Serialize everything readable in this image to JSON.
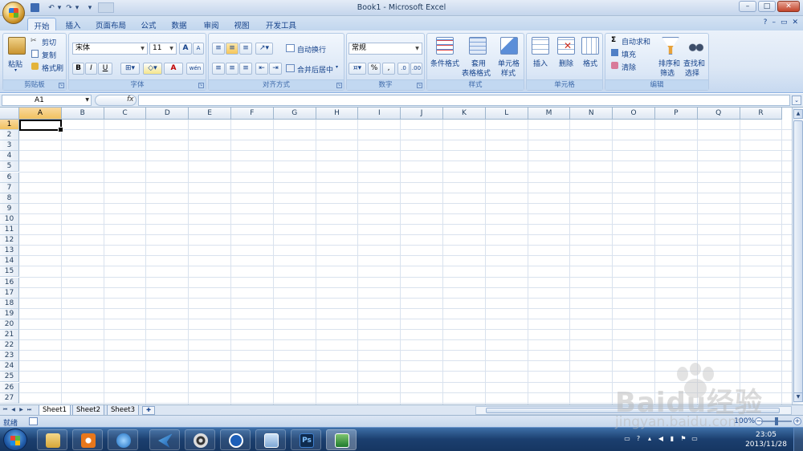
{
  "window": {
    "title": "Book1 - Microsoft Excel"
  },
  "qat": {
    "more": "▾"
  },
  "tabs": [
    "开始",
    "插入",
    "页面布局",
    "公式",
    "数据",
    "审阅",
    "视图",
    "开发工具"
  ],
  "clipboard": {
    "paste": "粘贴",
    "cut": "剪切",
    "copy": "复制",
    "format_painter": "格式刷",
    "label": "剪贴板"
  },
  "font": {
    "name": "宋体",
    "size": "11",
    "bold": "B",
    "italic": "I",
    "underline": "U",
    "grow": "A",
    "shrink": "A",
    "color_glyph": "A",
    "wen": "wén",
    "label": "字体"
  },
  "alignment": {
    "wrap": "自动换行",
    "merge": "合并后居中",
    "label": "对齐方式"
  },
  "number": {
    "format": "常规",
    "percent": "%",
    "comma": ",",
    "label": "数字"
  },
  "styles": {
    "conditional": "条件格式",
    "table_line1": "套用",
    "table_line2": "表格格式",
    "cell_styles_line1": "单元格",
    "cell_styles_line2": "样式",
    "label": "样式"
  },
  "cells": {
    "insert": "插入",
    "delete": "删除",
    "format": "格式",
    "label": "单元格"
  },
  "editing": {
    "autosum": "自动求和",
    "fill": "填充",
    "clear": "清除",
    "sort_line1": "排序和",
    "sort_line2": "筛选",
    "find_line1": "查找和",
    "find_line2": "选择",
    "label": "编辑"
  },
  "formula_bar": {
    "name_box": "A1",
    "fx": "fx",
    "formula": ""
  },
  "grid": {
    "columns": [
      "A",
      "B",
      "C",
      "D",
      "E",
      "F",
      "G",
      "H",
      "I",
      "J",
      "K",
      "L",
      "M",
      "N",
      "O",
      "P",
      "Q",
      "R"
    ],
    "rows": [
      "1",
      "2",
      "3",
      "4",
      "5",
      "6",
      "7",
      "8",
      "9",
      "10",
      "11",
      "12",
      "13",
      "14",
      "15",
      "16",
      "17",
      "18",
      "19",
      "20",
      "21",
      "22",
      "23",
      "24",
      "25",
      "26",
      "27"
    ],
    "active_cell": "A1"
  },
  "sheets": [
    "Sheet1",
    "Sheet2",
    "Sheet3"
  ],
  "active_sheet": "Sheet1",
  "status": {
    "ready": "就绪",
    "zoom": "100%"
  },
  "clock": {
    "time": "23:05",
    "date": "2013/11/28"
  },
  "watermark": {
    "brand": "Baidu经验",
    "url": "jingyan.baidu.com"
  },
  "colors": {
    "accent": "#15428b",
    "ribbon_bg": "#dbe7f6",
    "taskbar": "#1b3f6f",
    "selected_header": "#f1c15f"
  }
}
